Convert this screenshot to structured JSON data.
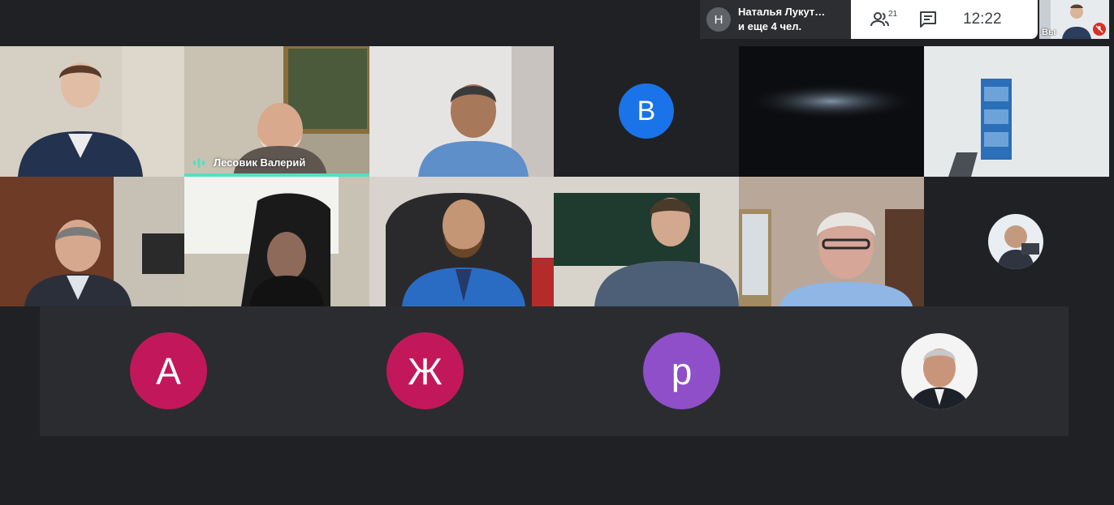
{
  "presenter": {
    "avatar_letter": "Н",
    "line1": "Наталья Лукут…",
    "line2": "и еще 4 чел."
  },
  "controls": {
    "people_icon": "people-icon",
    "people_count": "21",
    "chat_icon": "chat-icon",
    "time": "12:22"
  },
  "self_view": {
    "label": "Вы",
    "mic_icon": "mic-off-icon"
  },
  "tiles": {
    "speaker_name": "Лесовик Валерий",
    "avatar_v": "В",
    "avatar_a": "А",
    "avatar_zh": "Ж",
    "avatar_r": "р"
  },
  "colors": {
    "background": "#202124",
    "speaker_accent": "#55dfc3",
    "avatar_blue": "#1a73e8",
    "avatar_crimson": "#c2185b",
    "avatar_purple": "#8e4fc9",
    "mic_off": "#d93025"
  }
}
